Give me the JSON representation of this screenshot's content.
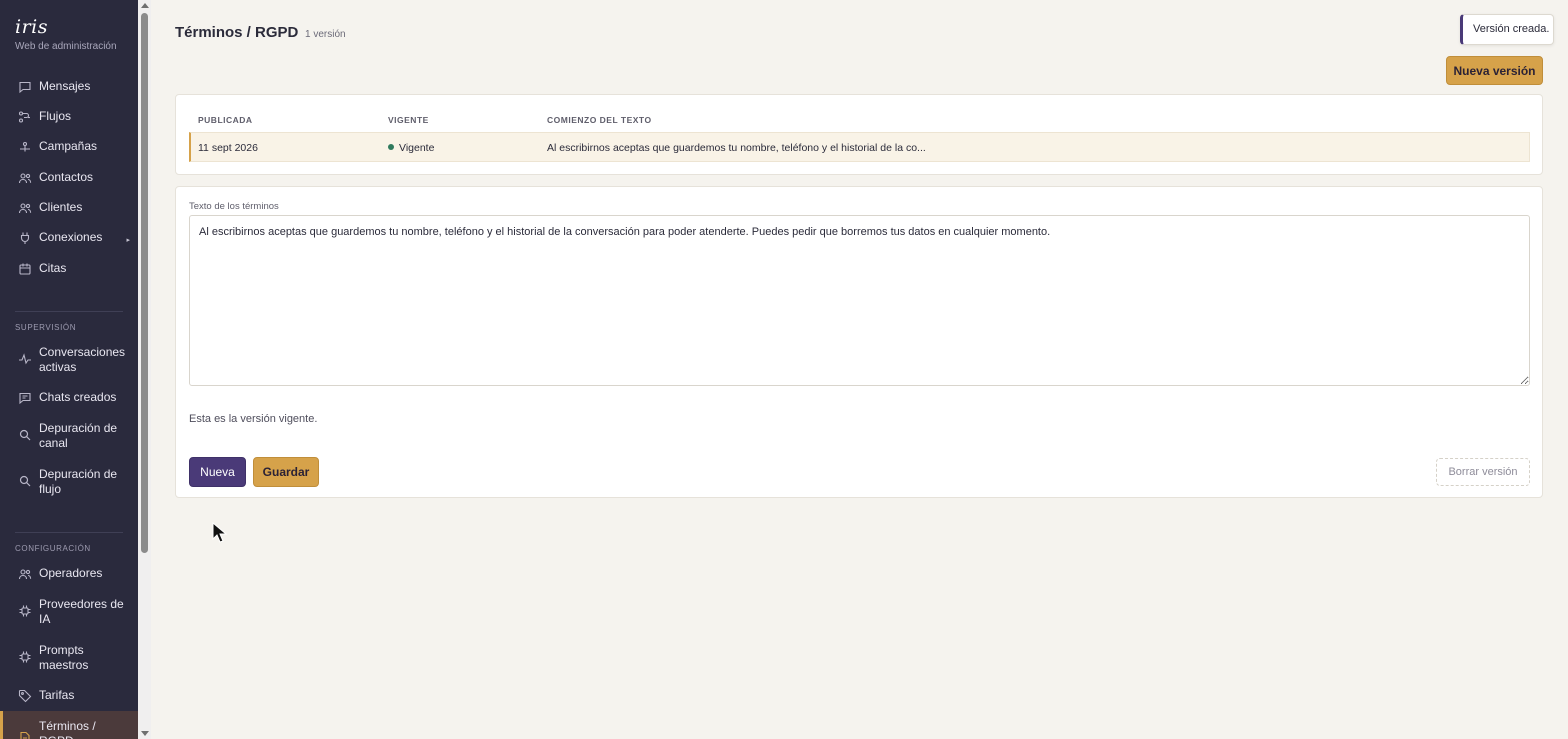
{
  "sidebar": {
    "logo": "iris",
    "subtitle": "Web de administración",
    "main_items": [
      {
        "label": "Mensajes",
        "icon": "message-icon"
      },
      {
        "label": "Flujos",
        "icon": "flow-icon"
      },
      {
        "label": "Campañas",
        "icon": "campaign-icon"
      },
      {
        "label": "Contactos",
        "icon": "users-icon"
      },
      {
        "label": "Clientes",
        "icon": "users-icon"
      },
      {
        "label": "Conexiones",
        "icon": "plug-icon",
        "arrow": "▸"
      },
      {
        "label": "Citas",
        "icon": "calendar-icon"
      }
    ],
    "section_supervision": "SUPERVISIÓN",
    "supervision_items": [
      {
        "label": "Conversaciones activas",
        "icon": "activity-icon"
      },
      {
        "label": "Chats creados",
        "icon": "chat-icon"
      },
      {
        "label": "Depuración de canal",
        "icon": "search-icon"
      },
      {
        "label": "Depuración de flujo",
        "icon": "search-icon"
      }
    ],
    "section_config": "CONFIGURACIÓN",
    "config_items": [
      {
        "label": "Operadores",
        "icon": "users-icon"
      },
      {
        "label": "Proveedores de IA",
        "icon": "chip-icon"
      },
      {
        "label": "Prompts maestros",
        "icon": "chip-icon"
      },
      {
        "label": "Tarifas",
        "icon": "tag-icon"
      },
      {
        "label": "Términos / RGPD",
        "icon": "document-icon",
        "active": true
      }
    ]
  },
  "header": {
    "title": "Términos / RGPD",
    "count": "1 versión",
    "toast": "Versión creada.",
    "new_version_button": "Nueva versión"
  },
  "versions_table": {
    "columns": [
      "PUBLICADA",
      "VIGENTE",
      "COMIENZO DEL TEXTO"
    ],
    "rows": [
      {
        "published": "11 sept 2026",
        "status": "Vigente",
        "text_start": "Al escribirnos aceptas que guardemos tu nombre, teléfono y el historial de la co..."
      }
    ]
  },
  "editor": {
    "label": "Texto de los términos",
    "text": "Al escribirnos aceptas que guardemos tu nombre, teléfono y el historial de la conversación para poder atenderte. Puedes pedir que borremos tus datos en cualquier momento.",
    "status": "Esta es la versión vigente.",
    "new_button": "Nueva",
    "save_button": "Guardar",
    "delete_button": "Borrar versión"
  },
  "colors": {
    "sidebar_bg": "#2a2a3d",
    "accent_gold": "#d6a24a",
    "accent_purple": "#4a3a78",
    "page_bg": "#f5f3ee",
    "status_green": "#2f7a5d"
  }
}
